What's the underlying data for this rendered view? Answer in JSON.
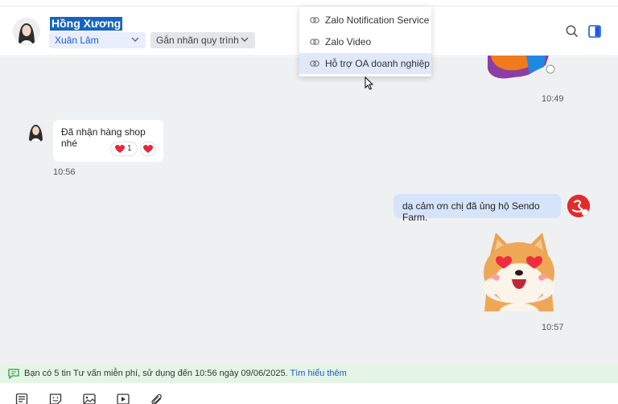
{
  "header": {
    "contact_name": "Hồng Xương",
    "assignee": "Xuân Lâm",
    "tag_placeholder": "Gắn nhãn quy trình"
  },
  "dropdown_menu": {
    "items": [
      {
        "label": "Zalo Notification Service"
      },
      {
        "label": "Zalo Video"
      },
      {
        "label": "Hỗ trợ OA doanh nghiệp"
      }
    ]
  },
  "messages": {
    "top_time": "10:49",
    "incoming": {
      "text": "Đã nhận hàng shop nhé",
      "reaction_count": "1",
      "time": "10:56"
    },
    "outgoing": {
      "text": "dạ cảm ơn chị đã ủng hộ Sendo Farm."
    },
    "sticker_time": "10:57"
  },
  "banner": {
    "text": "Bạn có 5 tin Tư vấn miễn phí, sử dụng đến 10:56 ngày 09/06/2025.",
    "link": "Tìm hiểu thêm"
  },
  "colors": {
    "accent": "#1a5bd8",
    "outgoing_bubble": "#d6e4fb",
    "banner_bg": "#e4f5e6",
    "chat_bg": "#eef0f2"
  },
  "icons": {
    "header": [
      "search-icon",
      "sidebar-toggle-icon"
    ],
    "toolbar": [
      "text-format-icon",
      "sticker-icon",
      "image-icon",
      "video-icon",
      "attach-icon"
    ]
  }
}
